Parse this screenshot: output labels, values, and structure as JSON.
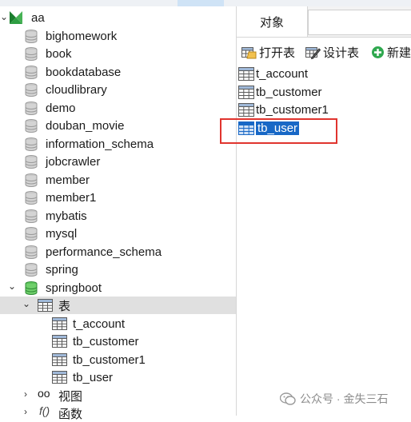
{
  "connection": {
    "name": "aa"
  },
  "databases": [
    "bighomework",
    "book",
    "bookdatabase",
    "cloudlibrary",
    "demo",
    "douban_movie",
    "information_schema",
    "jobcrawler",
    "member",
    "member1",
    "mybatis",
    "mysql",
    "performance_schema",
    "spring",
    "springboot"
  ],
  "expanded_db": {
    "tables_node": "表",
    "tables": [
      "t_account",
      "tb_customer",
      "tb_customer1",
      "tb_user"
    ],
    "views_node": "视图",
    "functions_node": "函数"
  },
  "right_panel": {
    "tab": "对象",
    "toolbar": {
      "open": "打开表",
      "design": "设计表",
      "new": "新建"
    },
    "objects": [
      "t_account",
      "tb_customer",
      "tb_customer1",
      "tb_user"
    ],
    "selected": "tb_user"
  },
  "watermark": "公众号 · 金失三石"
}
